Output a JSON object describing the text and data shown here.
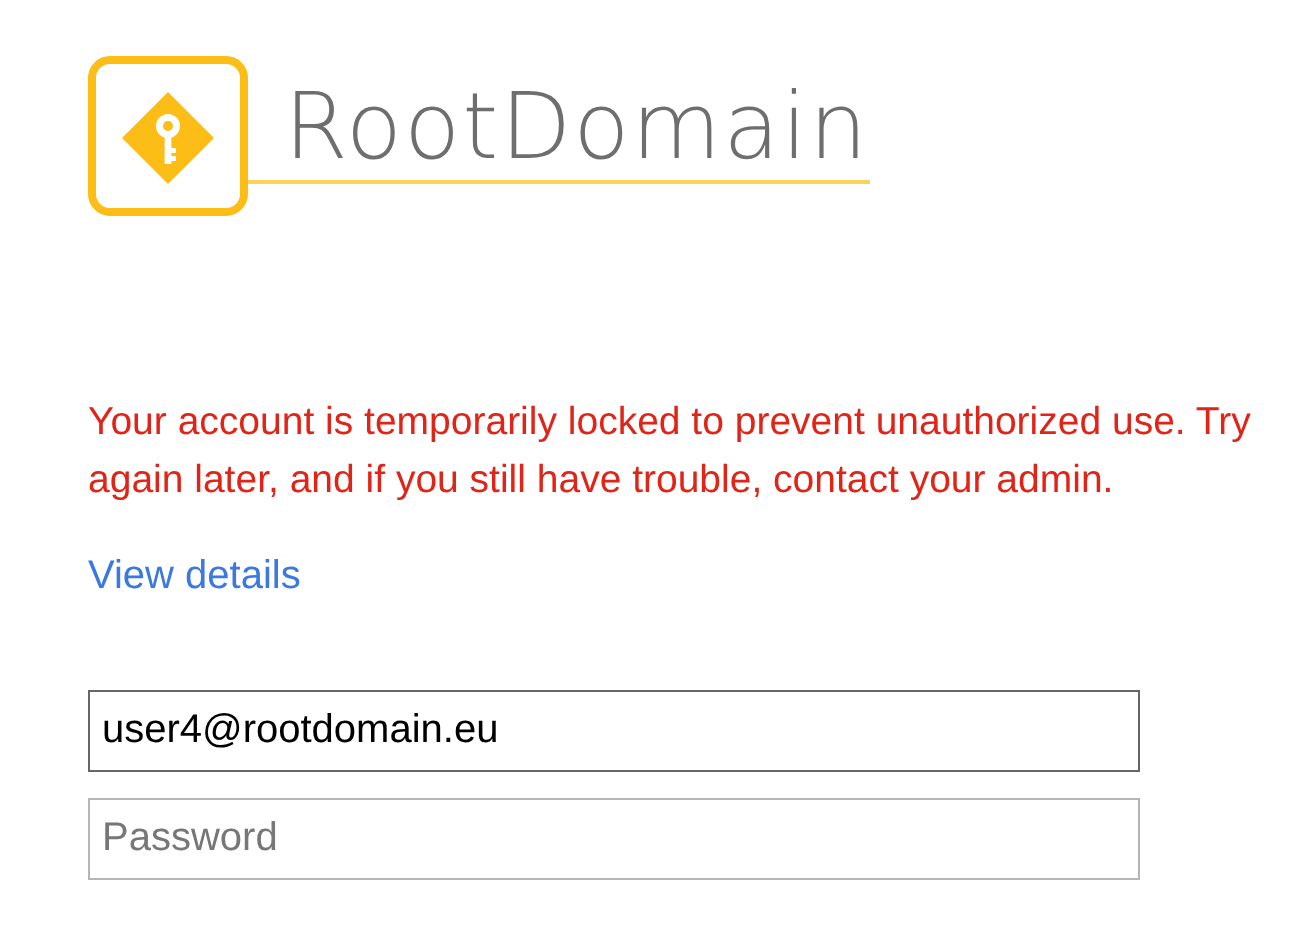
{
  "logo": {
    "text": "RootDomain"
  },
  "error": {
    "message": "Your account is temporarily locked to prevent unauthorized use. Try again later, and if you still have trouble, contact your admin."
  },
  "details_link": {
    "label": "View details"
  },
  "fields": [
    {
      "kind": "email",
      "value": "user4@rootdomain.eu",
      "focused": true
    },
    {
      "kind": "password",
      "placeholder": "Password",
      "focused": false
    }
  ]
}
